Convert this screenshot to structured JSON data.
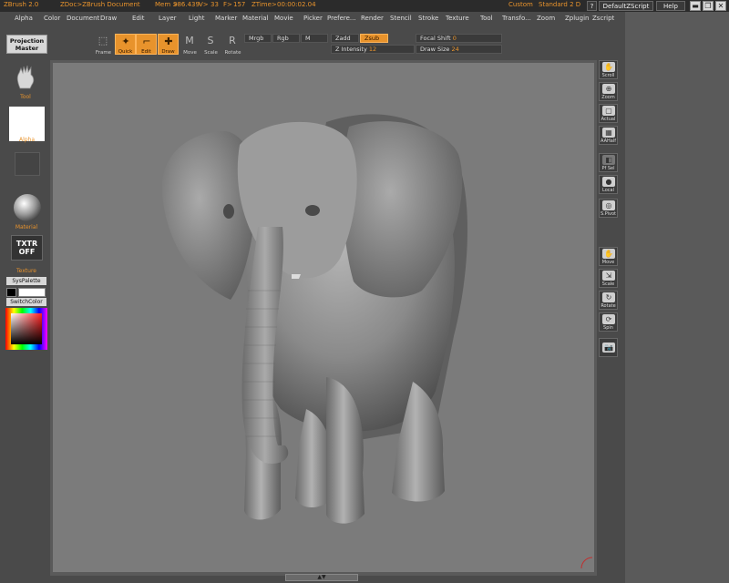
{
  "titlebar": {
    "app": "ZBrush 2.0",
    "doc": "ZDoc>ZBrush Document",
    "mem_label": "Mem >",
    "mem": "386.439",
    "v_label": "V>",
    "v": "33",
    "f_label": "F>",
    "f": "157",
    "ztime_label": "ZTime>",
    "ztime": "00:00:02.04",
    "custom": "Custom",
    "layout": "Standard 2 D",
    "help_q": "?",
    "default_script": "DefaultZScript",
    "help": "Help",
    "win_min": "▬",
    "win_restore": "❐",
    "win_close": "✕"
  },
  "menu": [
    "Alpha",
    "Color",
    "Document",
    "Draw",
    "Edit",
    "Layer",
    "Light",
    "Marker",
    "Material",
    "Movie",
    "Picker",
    "Prefere...",
    "Render",
    "Stencil",
    "Stroke",
    "Texture",
    "Tool",
    "Transfo...",
    "Zoom",
    "Zplugin",
    "Zscript"
  ],
  "top": {
    "projection_master": "Projection Master",
    "frame": "Frame",
    "quick": "Quick",
    "edit": "Edit",
    "draw": "Draw",
    "move": "Move",
    "scale": "Scale",
    "rotate": "Rotate",
    "mrgb": "Mrgb",
    "rgb": "Rgb",
    "m": "M",
    "zadd": "Zadd",
    "zsub": "Zsub",
    "z_intensity_label": "Z Intensity",
    "z_intensity": "12",
    "focal_shift_label": "Focal Shift",
    "focal_shift": "0",
    "draw_size_label": "Draw Size",
    "draw_size": "24"
  },
  "left": {
    "tool": "Tool",
    "alpha": "Alpha",
    "material": "Material",
    "txtr_off_1": "TXTR",
    "txtr_off_2": "OFF",
    "texture": "Texture",
    "syspalette": "SysPalette",
    "switchcolor": "SwitchColor"
  },
  "right": [
    "Scroll",
    "Zoom",
    "Actual",
    "AAHalf",
    "Pf Sel",
    "Local",
    "S.Pivot",
    "Move",
    "Scale",
    "Rotate",
    "Spin",
    ""
  ],
  "colors": {
    "accent": "#e8932c",
    "canvas": "#7b7b7b"
  }
}
